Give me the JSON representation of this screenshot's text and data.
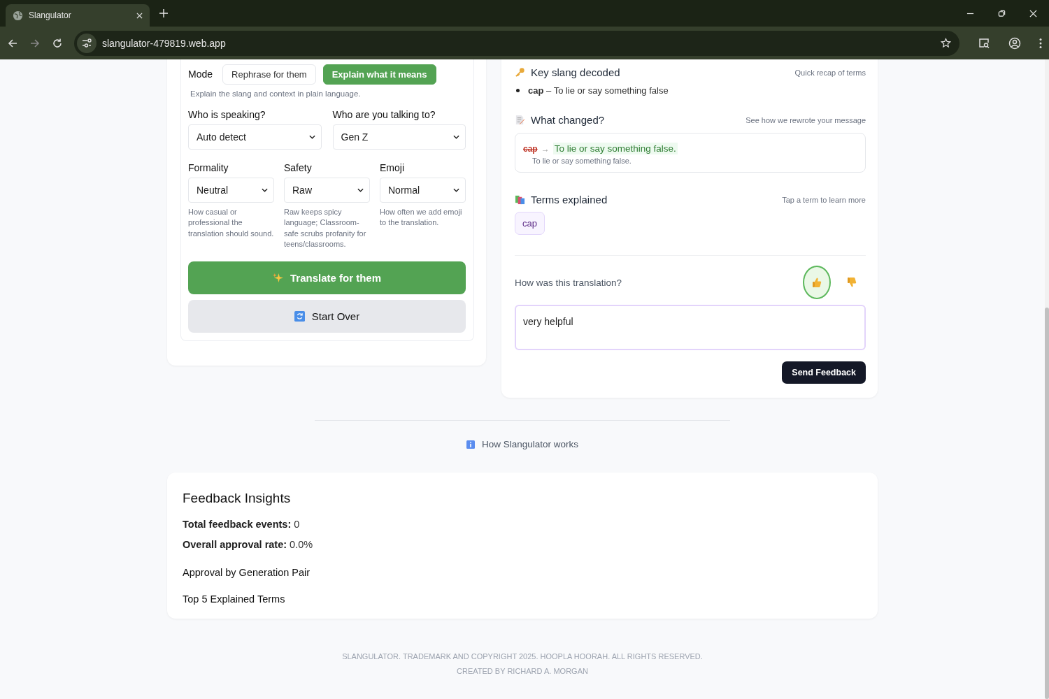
{
  "browser": {
    "tab_title": "Slangulator",
    "url": "slangulator-479819.web.app"
  },
  "mode": {
    "label": "Mode",
    "options": [
      {
        "label": "Rephrase for them",
        "selected": false
      },
      {
        "label": "Explain what it means",
        "selected": true
      }
    ],
    "description": "Explain the slang and context in plain language."
  },
  "audience": [
    {
      "label": "Who is speaking?",
      "value": "Auto detect"
    },
    {
      "label": "Who are you talking to?",
      "value": "Gen Z"
    }
  ],
  "settings": [
    {
      "label": "Formality",
      "value": "Neutral",
      "help": "How casual or professional the translation should sound."
    },
    {
      "label": "Safety",
      "value": "Raw",
      "help": "Raw keeps spicy language; Classroom-safe scrubs profanity for teens/classrooms."
    },
    {
      "label": "Emoji",
      "value": "Normal",
      "help": "How often we add emoji to the translation."
    }
  ],
  "actions": [
    {
      "label": "Translate for them",
      "kind": "primary"
    },
    {
      "label": "Start Over",
      "kind": "secondary"
    }
  ],
  "key_slang": {
    "title": "Key slang decoded",
    "note": "Quick recap of terms",
    "items": [
      {
        "term": "cap",
        "definition": "– To lie or say something false"
      }
    ]
  },
  "changes": {
    "title": "What changed?",
    "note": "See how we rewrote your message",
    "items": [
      {
        "from": "cap",
        "arrow": "→",
        "to": "To lie or say something false.",
        "explanation": "To lie or say something false."
      }
    ]
  },
  "terms": {
    "title": "Terms explained",
    "note": "Tap a term to learn more",
    "chips": [
      "cap"
    ]
  },
  "feedback": {
    "question": "How was this translation?",
    "ratings": [
      {
        "kind": "up",
        "selected": true
      },
      {
        "kind": "down",
        "selected": false
      }
    ],
    "comment": "very helpful",
    "button": "Send Feedback"
  },
  "how_link": "How Slangulator works",
  "insights": {
    "title": "Feedback Insights",
    "stats": [
      {
        "label": "Total feedback events:",
        "value": "0"
      },
      {
        "label": "Overall approval rate:",
        "value": "0.0%"
      }
    ],
    "sections": [
      "Approval by Generation Pair",
      "Top 5 Explained Terms"
    ]
  },
  "footer": [
    "SLANGULATOR. TRADEMARK AND COPYRIGHT 2025. HOOPLA HOORAH. ALL RIGHTS RESERVED.",
    "CREATED BY RICHARD A. MORGAN"
  ]
}
